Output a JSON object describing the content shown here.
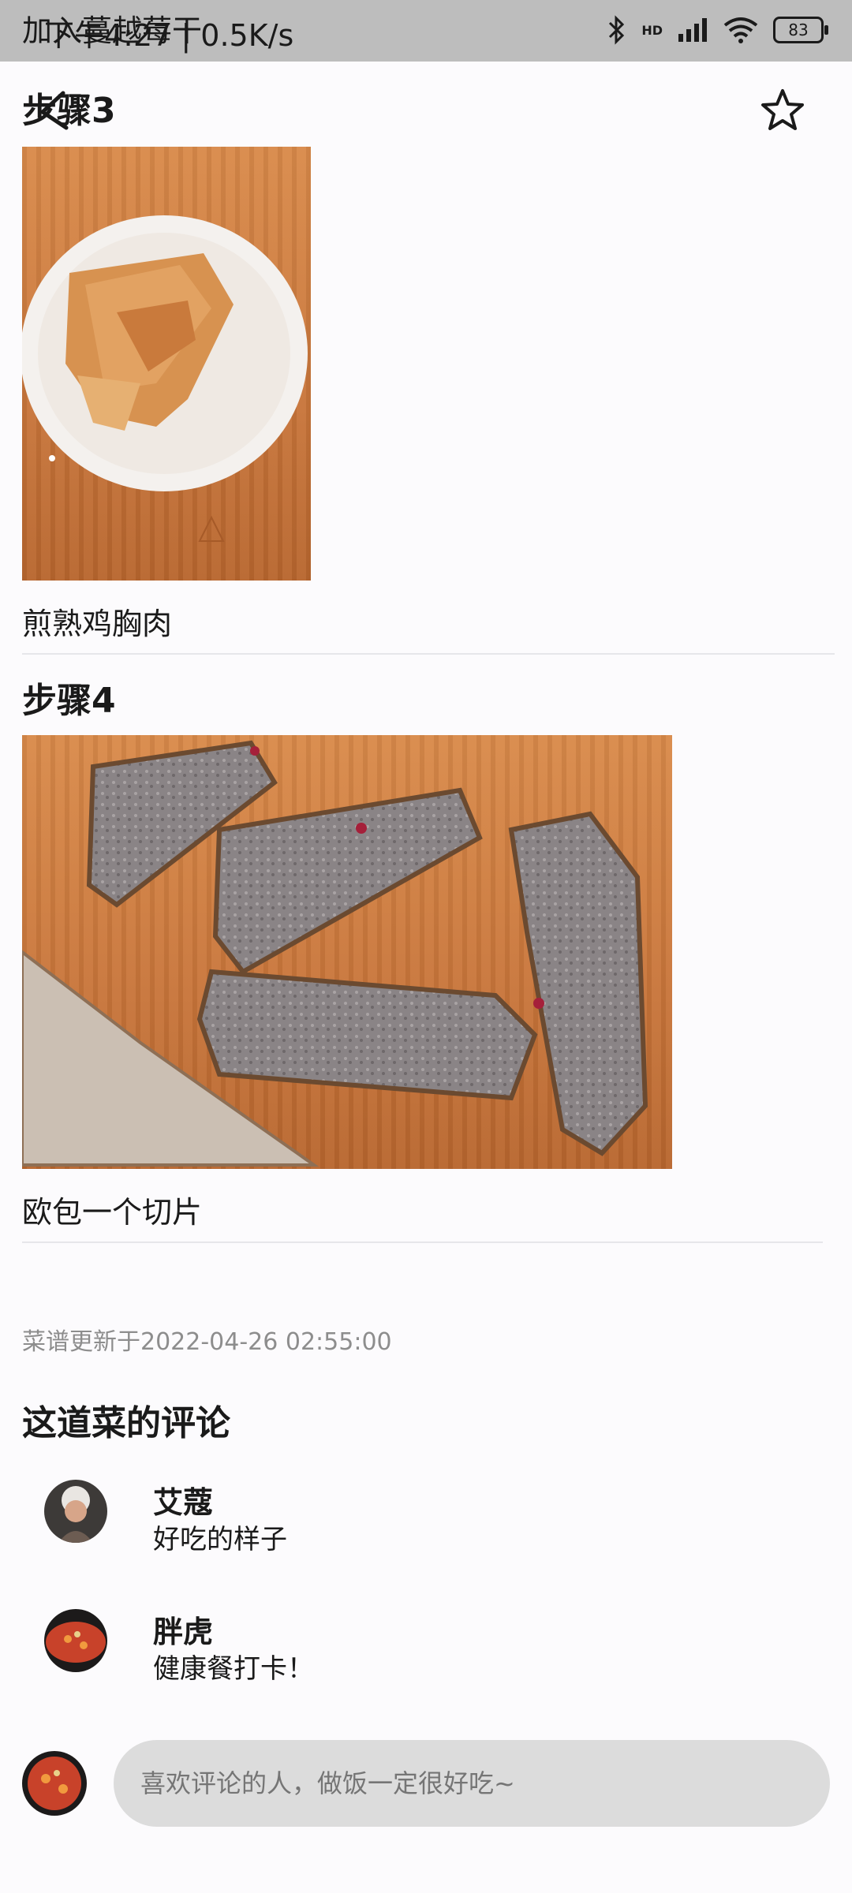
{
  "status_bar": {
    "time": "下午4:27 | 0.5K/s",
    "network_type": "HD",
    "battery": "83"
  },
  "overlay_title": "加入蔓越莓干",
  "steps": [
    {
      "title": "步骤3",
      "caption": "煎熟鸡胸肉"
    },
    {
      "title": "步骤4",
      "caption": "欧包一个切片"
    }
  ],
  "updated_text": "菜谱更新于2022-04-26 02:55:00",
  "comments_title": "这道菜的评论",
  "comments": [
    {
      "name": "艾蔻",
      "text": "好吃的样子"
    },
    {
      "name": "胖虎",
      "text": "健康餐打卡！"
    }
  ],
  "comment_input": {
    "placeholder": "喜欢评论的人，做饭一定很好吃~"
  }
}
